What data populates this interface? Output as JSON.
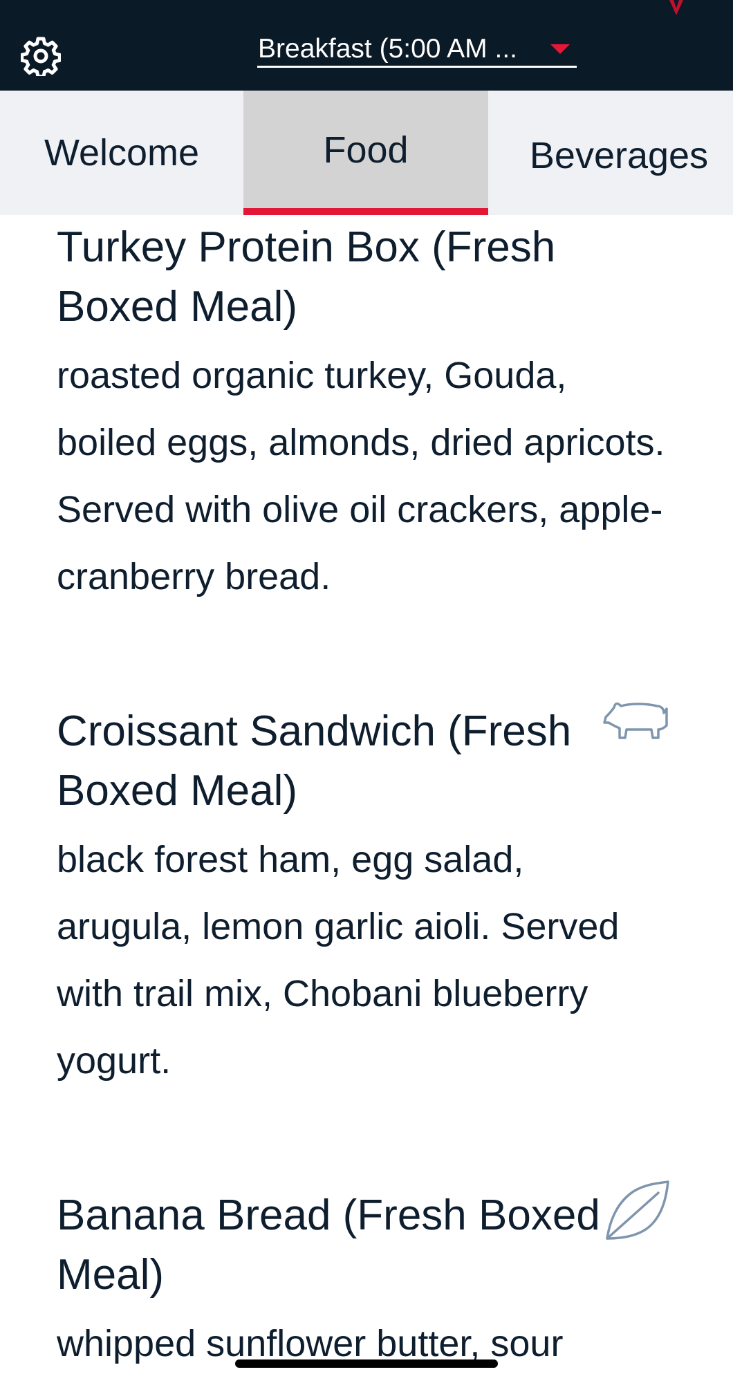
{
  "header": {
    "meal_period": "Breakfast (5:00 AM ...",
    "settings_icon": "gear-icon",
    "logo_icon": "delta-widget-icon",
    "accent_color": "#e31837",
    "bar_color": "#0b1a27"
  },
  "tabs": [
    {
      "label": "Welcome",
      "selected": false
    },
    {
      "label": "Food",
      "selected": true
    },
    {
      "label": "Beverages",
      "selected": false
    }
  ],
  "menu_items": [
    {
      "title": "Turkey Protein Box (Fresh Boxed Meal)",
      "description": "roasted organic turkey, Gouda, boiled eggs, almonds, dried apricots. Served with olive oil crackers, apple-cranberry bread.",
      "icon": ""
    },
    {
      "title": "Croissant Sandwich (Fresh Boxed Meal)",
      "description": "black forest ham, egg salad, arugula, lemon garlic aioli. Served with trail mix, Chobani blueberry yogurt.",
      "icon": "pork-icon"
    },
    {
      "title": "Banana Bread (Fresh Boxed Meal)",
      "description": "whipped sunflower butter, sour",
      "icon": "leaf-icon"
    }
  ]
}
